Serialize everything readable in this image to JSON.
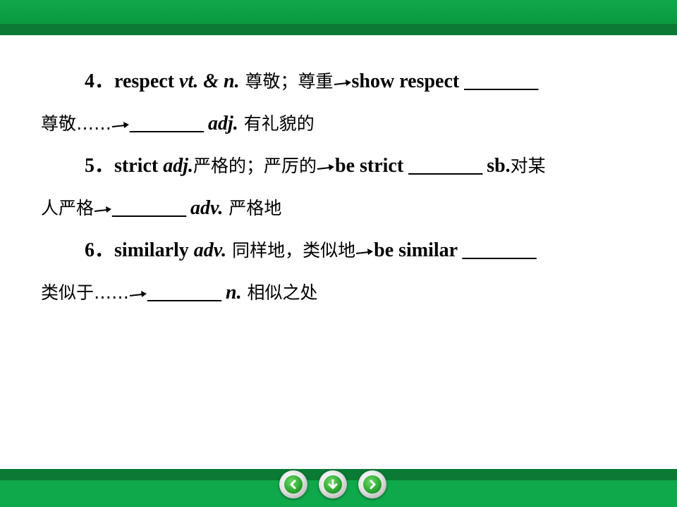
{
  "items": [
    {
      "l1": {
        "num": "4．",
        "word": "respect ",
        "pos": "vt. & n.",
        "meaning": " 尊敬；尊重",
        "phrase": "show respect ",
        "blank": "________"
      },
      "l2": {
        "meaning": "尊敬……",
        "blank": "________",
        "pos": " adj.",
        "meaning2": " 有礼貌的"
      }
    },
    {
      "l1": {
        "num": "5．",
        "word": "strict ",
        "pos": "adj.",
        "meaning": "严格的；严厉的",
        "phrase": "be strict ",
        "blank": "________",
        "phrase2": " sb.",
        "meaning2": "对某"
      },
      "l2": {
        "meaning": "人严格",
        "blank": "________",
        "pos": " adv.",
        "meaning2": " 严格地"
      }
    },
    {
      "l1": {
        "num": "6．",
        "word": "similarly ",
        "pos": "adv.",
        "meaning": " 同样地，类似地",
        "phrase": "be similar ",
        "blank": "________"
      },
      "l2": {
        "meaning": "类似于……",
        "blank": "________",
        "pos": " n.",
        "meaning2": " 相似之处"
      }
    }
  ],
  "nav": {
    "prev_icon": "arrow-left-icon",
    "down_icon": "arrow-down-icon",
    "next_icon": "arrow-right-icon"
  },
  "colors": {
    "bar_light": "#0fa84a",
    "bar_dark": "#0a7a34",
    "button_green": "#2aa530"
  }
}
